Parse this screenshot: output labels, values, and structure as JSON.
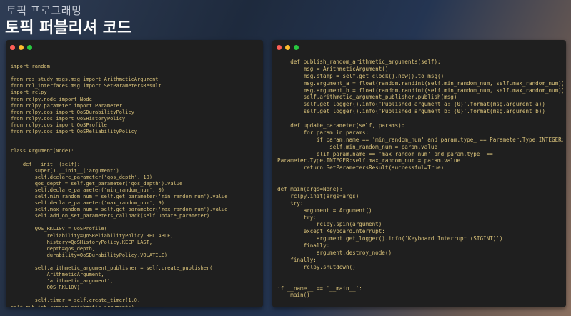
{
  "header": {
    "subtitle": "토픽 프로그래밍",
    "title": "토픽 퍼블리셔 코드"
  },
  "colors": {
    "window_red": "#ff5f57",
    "window_yellow": "#febc2e",
    "window_green": "#28c840",
    "code_text": "#d9c27a",
    "panel_bg": "#1f1f1f"
  },
  "left_code": [
    "",
    "import random",
    "",
    "from ros_study_msgs.msg import ArithmeticArgument",
    "from rcl_interfaces.msg import SetParametersResult",
    "import rclpy",
    "from rclpy.node import Node",
    "from rclpy.parameter import Parameter",
    "from rclpy.qos import QoSDurabilityPolicy",
    "from rclpy.qos import QoSHistoryPolicy",
    "from rclpy.qos import QoSProfile",
    "from rclpy.qos import QoSReliabilityPolicy",
    "",
    "",
    "class Argument(Node):",
    "",
    "    def __init__(self):",
    "        super().__init__('argument')",
    "        self.declare_parameter('qos_depth', 10)",
    "        qos_depth = self.get_parameter('qos_depth').value",
    "        self.declare_parameter('min_random_num', 0)",
    "        self.min_random_num = self.get_parameter('min_random_num').value",
    "        self.declare_parameter('max_random_num', 9)",
    "        self.max_random_num = self.get_parameter('max_random_num').value",
    "        self.add_on_set_parameters_callback(self.update_parameter)",
    "",
    "        QOS_RKL10V = QoSProfile(",
    "            reliability=QoSReliabilityPolicy.RELIABLE,",
    "            history=QoSHistoryPolicy.KEEP_LAST,",
    "            depth=qos_depth,",
    "            durability=QoSDurabilityPolicy.VOLATILE)",
    "",
    "        self.arithmetic_argument_publisher = self.create_publisher(",
    "            ArithmeticArgument,",
    "            'arithmetic_argument',",
    "            QOS_RKL10V)",
    "",
    "        self.timer = self.create_timer(1.0,",
    "self.publish_random_arithmetic_arguments)"
  ],
  "right_code": [
    "    def publish_random_arithmetic_arguments(self):",
    "        msg = ArithmeticArgument()",
    "        msg.stamp = self.get_clock().now().to_msg()",
    "        msg.argument_a = float(random.randint(self.min_random_num, self.max_random_num))",
    "        msg.argument_b = float(random.randint(self.min_random_num, self.max_random_num))",
    "        self.arithmetic_argument_publisher.publish(msg)",
    "        self.get_logger().info('Published argument a: {0}'.format(msg.argument_a))",
    "        self.get_logger().info('Published argument b: {0}'.format(msg.argument_b))",
    "",
    "    def update_parameter(self, params):",
    "        for param in params:",
    "            if param.name == 'min_random_num' and param.type_ == Parameter.Type.INTEGER:",
    "                self.min_random_num = param.value",
    "            elif param.name == 'max_random_num' and param.type_ ==",
    "Parameter.Type.INTEGER:self.max_random_num = param.value",
    "        return SetParametersResult(successful=True)",
    "",
    "",
    "def main(args=None):",
    "    rclpy.init(args=args)",
    "    try:",
    "        argument = Argument()",
    "        try:",
    "            rclpy.spin(argument)",
    "        except KeyboardInterrupt:",
    "            argument.get_logger().info('Keyboard Interrupt (SIGINT)')",
    "        finally:",
    "            argument.destroy_node()",
    "    finally:",
    "        rclpy.shutdown()",
    "",
    "",
    "if __name__ == '__main__':",
    "    main()"
  ]
}
